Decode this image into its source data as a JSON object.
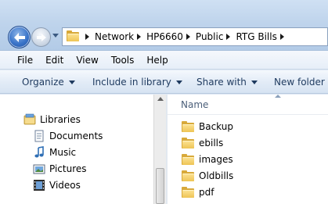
{
  "address": {
    "crumbs": [
      "Network",
      "HP6660",
      "Public",
      "RTG Bills"
    ]
  },
  "menu": {
    "items": [
      "File",
      "Edit",
      "View",
      "Tools",
      "Help"
    ]
  },
  "commands": {
    "organize": "Organize",
    "include_in_library": "Include in library",
    "share_with": "Share with",
    "new_folder": "New folder"
  },
  "nav_tree": {
    "libraries": "Libraries",
    "documents": "Documents",
    "music": "Music",
    "pictures": "Pictures",
    "videos": "Videos"
  },
  "content": {
    "column_name": "Name",
    "items": [
      "Backup",
      "ebills",
      "images",
      "Oldbills",
      "pdf"
    ]
  },
  "colors": {
    "accent": "#3a74c9",
    "folder": "#eec455"
  }
}
